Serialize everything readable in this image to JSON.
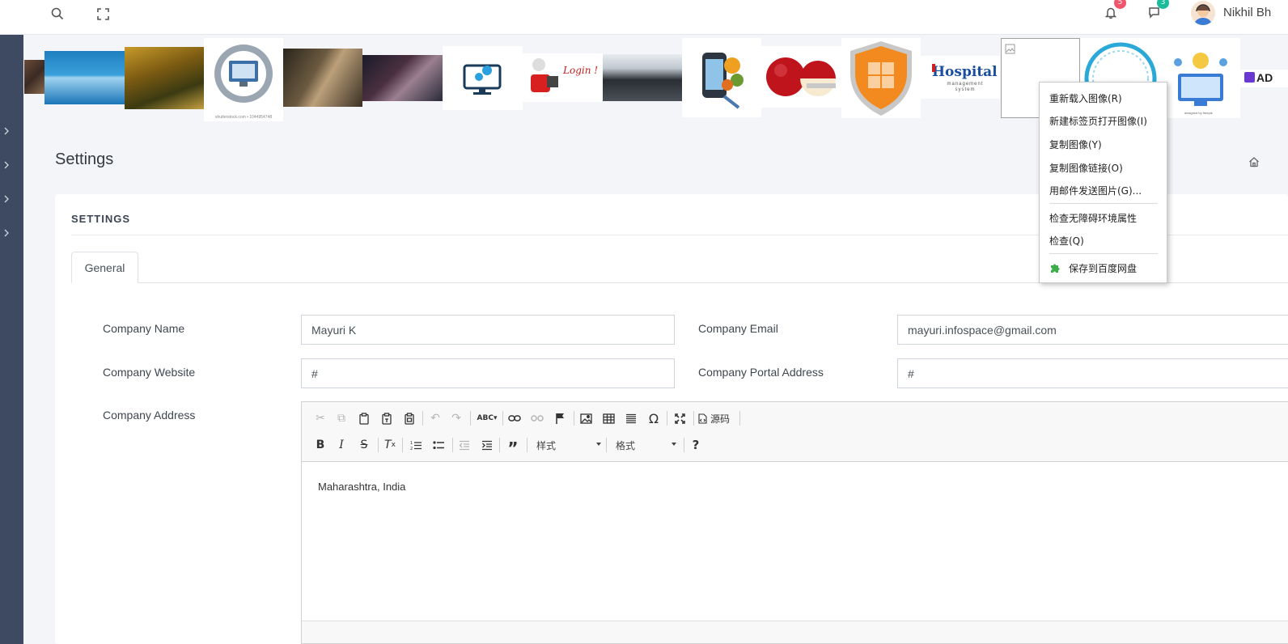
{
  "topbar": {
    "search_icon": "search-icon",
    "fullscreen_icon": "fullscreen-icon",
    "notifications_count": "5",
    "messages_count": "3",
    "user_name": "Nikhil Bh"
  },
  "colors": {
    "sidebar": "#3d4a62",
    "notif_badge": "#f1556c",
    "msg_badge": "#1abc9c",
    "background": "#f3f5f9"
  },
  "thumbnails": {
    "shutterstock_caption": "shutterstock.com • 1044954748",
    "login_text": "Login !",
    "hospital_title": "Hospital",
    "hospital_subtitle": "management system",
    "designed_caption": "designed by freepik",
    "ad_text": "AD"
  },
  "page": {
    "title": "Settings"
  },
  "card": {
    "title": "SETTINGS",
    "tabs": [
      {
        "label": "General"
      }
    ]
  },
  "form": {
    "company_name_label": "Company Name",
    "company_name_value": "Mayuri K",
    "company_email_label": "Company Email",
    "company_email_value": "mayuri.infospace@gmail.com",
    "company_website_label": "Company Website",
    "company_website_value": "#",
    "company_portal_label": "Company Portal Address",
    "company_portal_value": "#",
    "company_address_label": "Company Address"
  },
  "editor": {
    "source_label": "源码",
    "styles_label": "样式",
    "format_label": "格式",
    "content": "Maharashtra, India"
  },
  "context_menu": {
    "items": [
      "重新载入图像(R)",
      "新建标签页打开图像(I)",
      "复制图像(Y)",
      "复制图像链接(O)",
      "用邮件发送图片(G)...",
      "检查无障碍环境属性",
      "检查(Q)",
      "保存到百度网盘"
    ]
  }
}
